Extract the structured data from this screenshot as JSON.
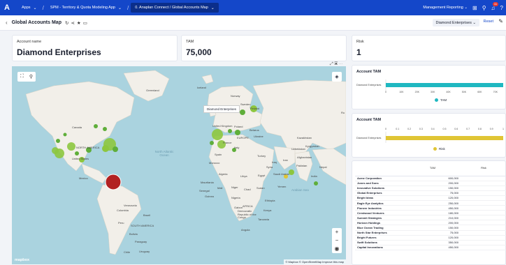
{
  "topbar": {
    "apps_label": "Apps",
    "crumbs": [
      "SPM - Territory & Quota Modeling App",
      "0. Anaplan Connect / Global Accounts Map"
    ],
    "mgmt_reporting": "Management Reporting",
    "notification_count": "11"
  },
  "page": {
    "title": "Global Accounts Map",
    "dropdown": "Diamond Enterprises",
    "reset_label": "Reset"
  },
  "kpis": [
    {
      "label": "Account name",
      "value": "Diamond Enterprises"
    },
    {
      "label": "TAM",
      "value": "75,000"
    },
    {
      "label": "Risk",
      "value": "1"
    }
  ],
  "map": {
    "tooltip": "Diamond Enterprises",
    "attribution": "© Mapbox © OpenStreetMap Improve this map",
    "logo": "mapbox",
    "labels": {
      "canada": "Canada",
      "north_america": "NORTH AMERICA",
      "united_states": "United States",
      "mexico": "Mexico",
      "south_america": "SOUTH AMERICA",
      "brazil": "Brazil",
      "venezuela": "Venezuela",
      "colombia": "Colombia",
      "peru": "Peru",
      "bolivia": "Bolivia",
      "paraguay": "Paraguay",
      "uruguay": "Uruguay",
      "chile": "Chile",
      "greenland": "Greenland",
      "iceland": "Iceland",
      "norway": "Norway",
      "sweden": "Sweden",
      "finland": "Finland",
      "united_kingdom": "United Kingdom",
      "poland": "Poland",
      "france": "France",
      "europe": "EUROPE",
      "ukraine": "Ukraine",
      "belarus": "Belarus",
      "spain": "Spain",
      "italy": "Italy",
      "turkey": "Turkey",
      "morocco": "Morocco",
      "algeria": "Algeria",
      "libya": "Libya",
      "egypt": "Egypt",
      "mali": "Mali",
      "niger": "Niger",
      "chad": "Chad",
      "sudan": "Sudan",
      "nigeria": "Nigeria",
      "ethiopia": "Ethiopia",
      "africa": "AFRICA",
      "drc": "Democratic Republic of the Congo",
      "angola": "Angola",
      "tanzania": "Tanzania",
      "kenya": "Kenya",
      "iraq": "Iraq",
      "iran": "Iran",
      "saudi_arabia": "Saudi Arabia",
      "yemen": "Yemen",
      "kazakhstan": "Kazakhstan",
      "uzbekistan": "Uzbekistan",
      "kyrgyzstan": "Kyrgyzstan",
      "afghanistan": "Afghanistan",
      "pakistan": "Pakistan",
      "india": "India",
      "nepal": "Nepal",
      "mauritania": "Mauritania",
      "senegal": "Senegal",
      "guinea": "Guinea",
      "gabon": "Gabon",
      "syria": "Syria",
      "ru": "Ru",
      "atlantic": "North Atlantic Ocean",
      "arabian_sea": "Arabian Sea"
    }
  },
  "tam_chart": {
    "title": "Account TAM",
    "legend": "TAM",
    "color": "#1fb8c1",
    "chart_data": {
      "type": "bar",
      "categories": [
        "Diamond Enterprises"
      ],
      "values": [
        75000
      ],
      "xlim": [
        0,
        75000
      ],
      "ticks": [
        "0",
        "10K",
        "20K",
        "30K",
        "40K",
        "50K",
        "60K",
        "70K"
      ]
    }
  },
  "risk_chart": {
    "title": "Account TAM",
    "legend": "Risk",
    "color": "#e0c534",
    "chart_data": {
      "type": "bar",
      "categories": [
        "Diamond Enterprises"
      ],
      "values": [
        1
      ],
      "xlim": [
        0,
        1
      ],
      "ticks": [
        "0",
        "0.1",
        "0.2",
        "0.3",
        "0.4",
        "0.5",
        "0.6",
        "0.7",
        "0.8",
        "0.9",
        "1"
      ]
    }
  },
  "table": {
    "headers": [
      "",
      "TAM",
      "Risk"
    ],
    "rows": [
      [
        "Acme Corporation",
        "600,000"
      ],
      [
        "Jones and Sons",
        "200,000"
      ],
      [
        "Innovative Solutions",
        "150,000"
      ],
      [
        "Global Enterprises",
        "75,000"
      ],
      [
        "Bright Ideas",
        "120,000"
      ],
      [
        "Eagle Eye Analytics",
        "250,000"
      ],
      [
        "Pioneer Industries",
        "450,000"
      ],
      [
        "Crestwood Ventures",
        "180,000"
      ],
      [
        "Summit Strategies",
        "210,000"
      ],
      [
        "Horizon Holdings",
        "200,000"
      ],
      [
        "Blue Ocean Trading",
        "150,000"
      ],
      [
        "North Star Enterprises",
        "75,000"
      ],
      [
        "Bright Futures",
        "120,000"
      ],
      [
        "Swift Solutions",
        "350,000"
      ],
      [
        "Capital Innovations",
        "450,000"
      ]
    ]
  },
  "colors": {
    "brand_blue": "#1447c9",
    "bubble_green": "#8dc63f",
    "highlight_red": "#b22222"
  }
}
